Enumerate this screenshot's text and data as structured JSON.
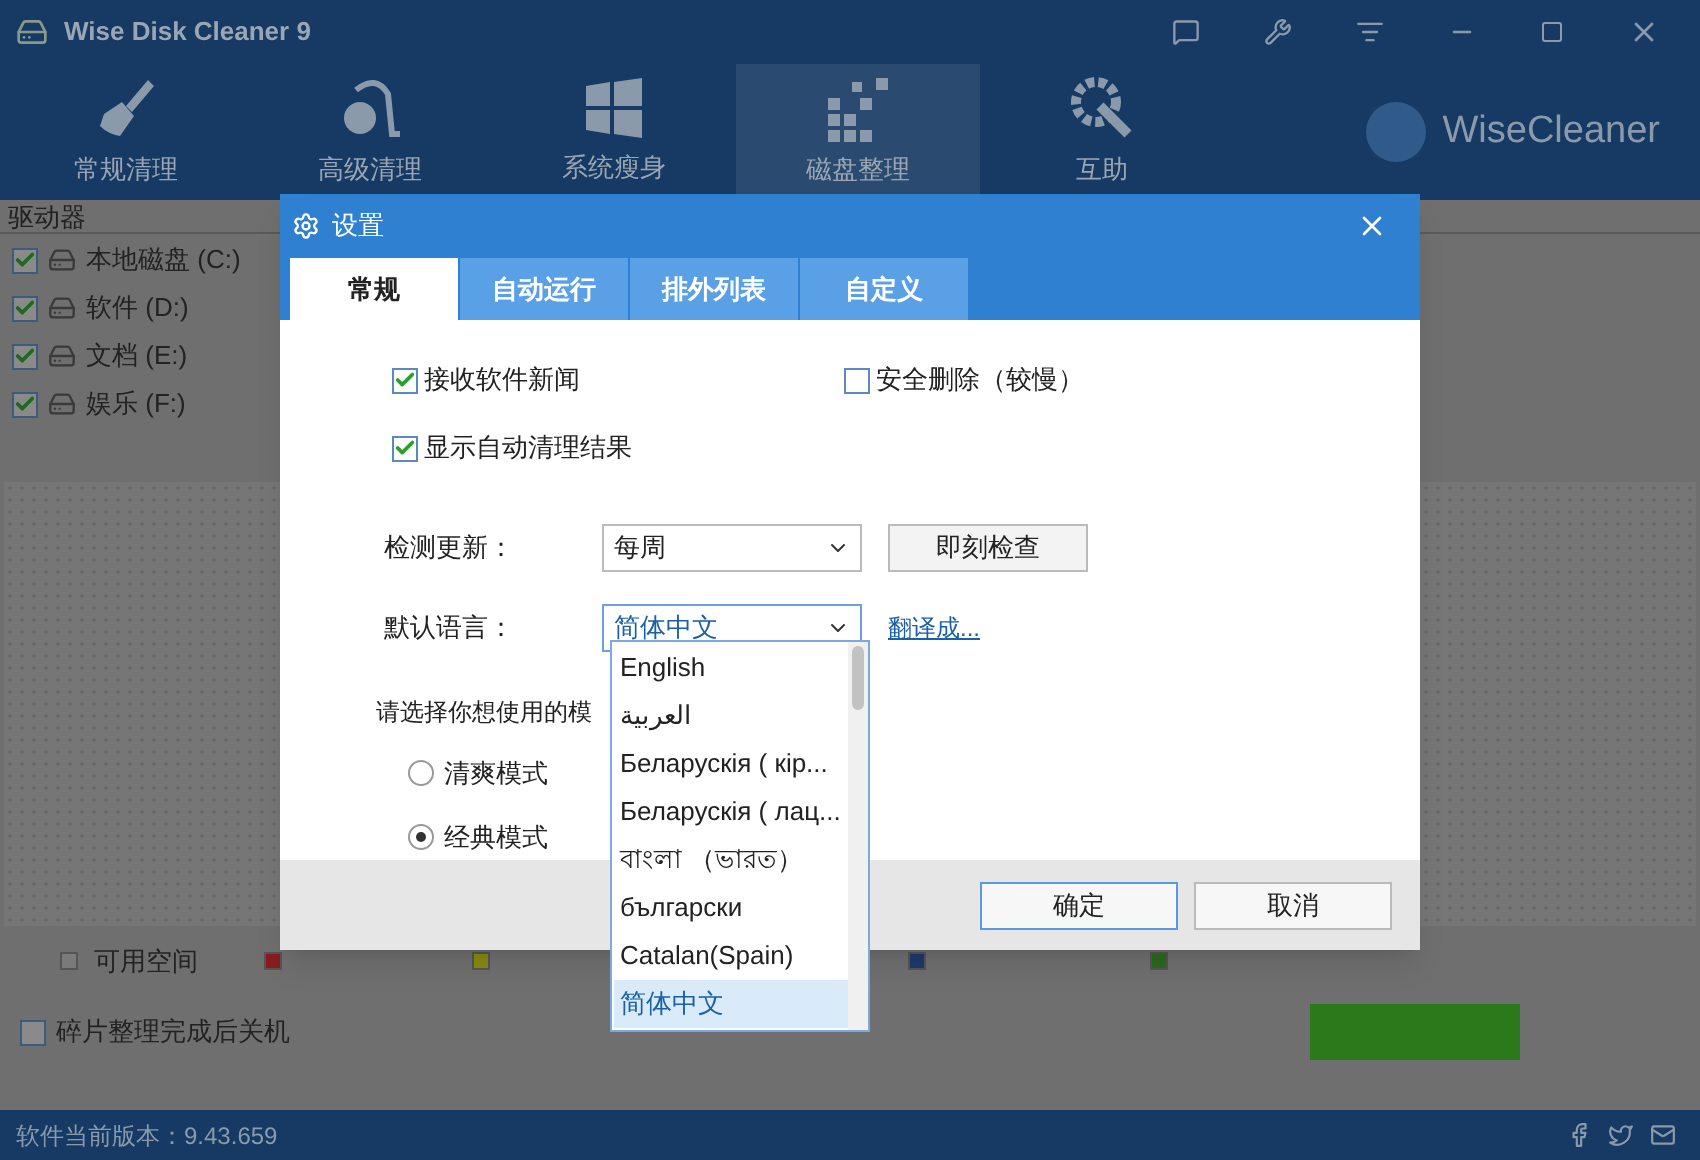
{
  "window": {
    "title": "Wise Disk Cleaner 9"
  },
  "nav": [
    {
      "label": "常规清理",
      "selected": false,
      "kind": "broom"
    },
    {
      "label": "高级清理",
      "selected": false,
      "kind": "vacuum"
    },
    {
      "label": "系统瘦身",
      "selected": false,
      "kind": "windows"
    },
    {
      "label": "磁盘整理",
      "selected": true,
      "kind": "blocks"
    },
    {
      "label": "互助",
      "selected": false,
      "kind": "tools"
    }
  ],
  "brand": "WiseCleaner",
  "drives": {
    "header": "驱动器",
    "items": [
      {
        "label": "本地磁盘 (C:)",
        "checked": true
      },
      {
        "label": "软件 (D:)",
        "checked": true
      },
      {
        "label": "文档 (E:)",
        "checked": true
      },
      {
        "label": "娱乐 (F:)",
        "checked": true
      }
    ]
  },
  "legend": [
    {
      "label": "可用空间",
      "color": "#7a7a7a"
    },
    {
      "color": "#8a1c1c"
    },
    {
      "color": "#8a8a10"
    },
    {
      "color": "#1c3a6e"
    },
    {
      "color": "#2a6a1c"
    }
  ],
  "shutdown": {
    "label": "碎片整理完成后关机",
    "checked": false
  },
  "status_bar": {
    "version": "软件当前版本：9.43.659"
  },
  "dialog": {
    "title": "设置",
    "tabs": [
      {
        "label": "常规",
        "selected": true
      },
      {
        "label": "自动运行",
        "selected": false
      },
      {
        "label": "排外列表",
        "selected": false
      },
      {
        "label": "自定义",
        "selected": false
      }
    ],
    "options": [
      {
        "label": "接收软件新闻",
        "checked": true
      },
      {
        "label": "安全删除（较慢）",
        "checked": false
      },
      {
        "label": "显示自动清理结果",
        "checked": true
      }
    ],
    "update": {
      "label": "检测更新：",
      "value": "每周",
      "button": "即刻检查"
    },
    "language": {
      "label": "默认语言：",
      "value": "简体中文",
      "link": "翻译成...",
      "options": [
        {
          "label": "English",
          "selected": false
        },
        {
          "label": "العربية",
          "selected": false
        },
        {
          "label": "Беларускія ( кір...",
          "selected": false
        },
        {
          "label": "Беларускія ( лац...",
          "selected": false
        },
        {
          "label": "বাংলা （ভারত）",
          "selected": false
        },
        {
          "label": "български",
          "selected": false
        },
        {
          "label": "Catalan(Spain)",
          "selected": false
        },
        {
          "label": "简体中文",
          "selected": true
        }
      ]
    },
    "mode": {
      "label": "请选择你想使用的模",
      "options": [
        {
          "label": "清爽模式",
          "selected": false
        },
        {
          "label": "经典模式",
          "selected": true
        }
      ]
    },
    "buttons": [
      "确定",
      "取消"
    ]
  }
}
